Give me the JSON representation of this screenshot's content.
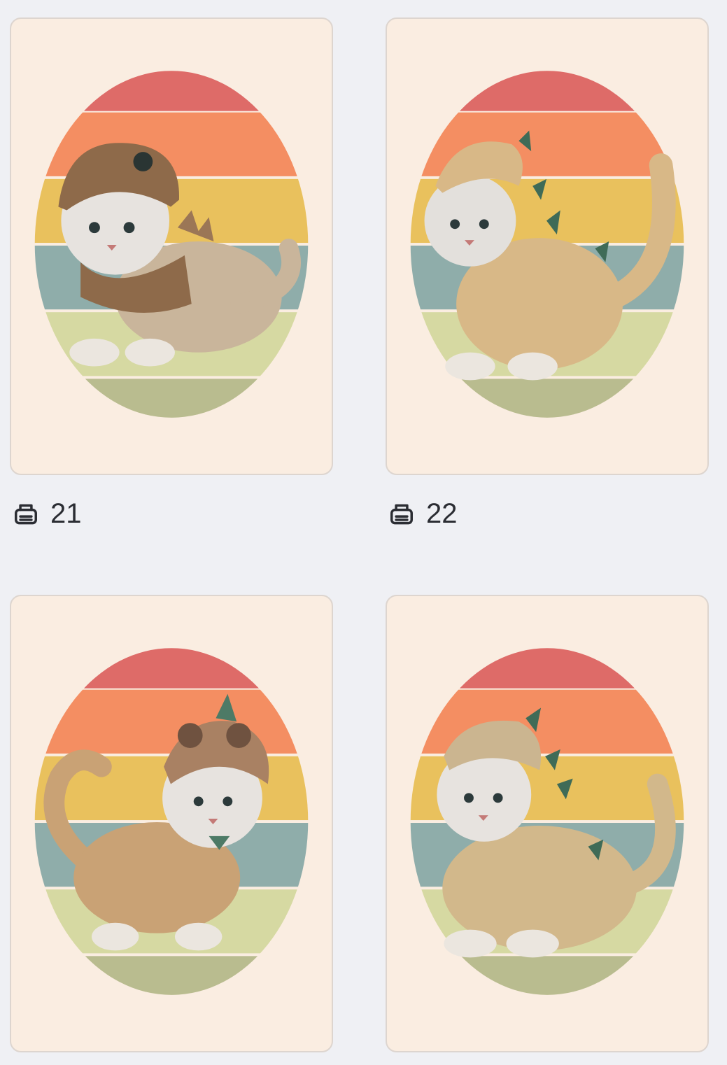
{
  "cards": [
    {
      "print_count": "21",
      "illustration": "snow-leopard-cub-in-brown-dinosaur-helmet-and-vest",
      "hood_color": "#8e6a4a",
      "spike_color": "#9b7656"
    },
    {
      "print_count": "22",
      "illustration": "snow-leopard-cub-in-spotted-dinosaur-costume-with-green-spikes",
      "hood_color": "#d8b887",
      "spike_color": "#3f6b57"
    },
    {
      "print_count": "",
      "illustration": "snow-leopard-cub-in-brown-dinosaur-hood-with-green-bow",
      "hood_color": "#a98163",
      "spike_color": "#4d7a66"
    },
    {
      "print_count": "",
      "illustration": "snow-leopard-cub-sitting-in-dinosaur-hood-with-green-spikes",
      "hood_color": "#cbb590",
      "spike_color": "#3f6b57"
    }
  ],
  "colors": {
    "page_background": "#eff0f4",
    "card_background": "#faede1",
    "stripes": [
      "#de6b68",
      "#f48e62",
      "#e9c15d",
      "#8fadaa",
      "#d6d9a2",
      "#b9bc8f"
    ],
    "print_icon": "#2b2d33"
  },
  "icons": {
    "print": "printer-icon"
  }
}
